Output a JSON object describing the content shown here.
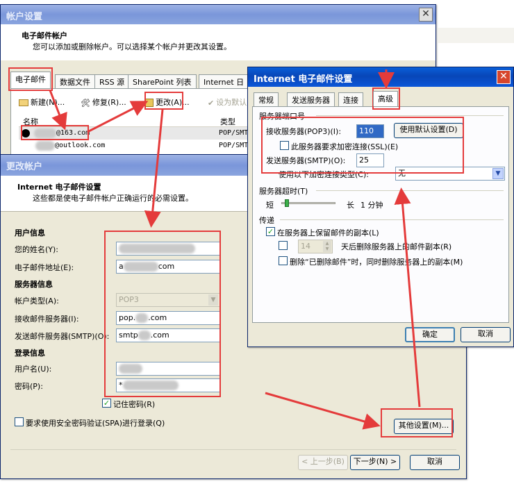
{
  "account_settings": {
    "title": "帐户设置",
    "heading": "电子邮件帐户",
    "description": "您可以添加或删除帐户。可以选择某个帐户并更改其设置。",
    "tabs": [
      "电子邮件",
      "数据文件",
      "RSS 源",
      "SharePoint 列表",
      "Internet 日"
    ],
    "toolbar": {
      "new": "新建(N)...",
      "repair": "修复(R)...",
      "change": "更改(A)...",
      "set_default": "设为默认"
    },
    "columns": {
      "name": "名称",
      "type": "类型"
    },
    "accounts": [
      {
        "name": "@163.com",
        "type": "POP/SMT"
      },
      {
        "name": "@outlook.com",
        "type": "POP/SMT"
      }
    ]
  },
  "change_account": {
    "title": "更改帐户",
    "heading": "Internet 电子邮件设置",
    "description": "这些都是使电子邮件帐户正确运行的必需设置。",
    "user_info": {
      "section": "用户信息",
      "name_label": "您的姓名(Y):",
      "email_label": "电子邮件地址(E):",
      "email_value": "com"
    },
    "server_info": {
      "section": "服务器信息",
      "account_type_label": "帐户类型(A):",
      "account_type_value": "POP3",
      "incoming_label": "接收邮件服务器(I):",
      "incoming_value": ".com",
      "outgoing_label": "发送邮件服务器(SMTP)(O):",
      "outgoing_value": ".com"
    },
    "login_info": {
      "section": "登录信息",
      "username_label": "用户名(U):",
      "password_label": "密码(P):",
      "password_value": "*"
    },
    "remember_password": "记住密码(R)",
    "spa": "要求使用安全密码验证(SPA)进行登录(Q)",
    "more_settings": "其他设置(M)...",
    "back": "< 上一步(B)",
    "next": "下一步(N) >",
    "cancel": "取消"
  },
  "internet_settings": {
    "title": "Internet 电子邮件设置",
    "tabs": [
      "常规",
      "发送服务器",
      "连接",
      "高级"
    ],
    "ports_section": "服务器端口号",
    "incoming_label": "接收服务器(POP3)(I):",
    "incoming_port": "110",
    "use_defaults": "使用默认设置(D)",
    "ssl_label": "此服务器要求加密连接(SSL)(E)",
    "outgoing_label": "发送服务器(SMTP)(O):",
    "outgoing_port": "25",
    "encryption_label": "使用以下加密连接类型(C):",
    "encryption_value": "无",
    "timeout_section": "服务器超时(T)",
    "timeout_short": "短",
    "timeout_long": "长",
    "timeout_value": "1 分钟",
    "delivery_section": "传递",
    "leave_copy": "在服务器上保留邮件的副本(L)",
    "remove_after_days": "14",
    "remove_after_label": "天后删除服务器上的邮件副本(R)",
    "remove_when_deleted": "删除“已删除邮件”时，同时删除服务器上的副本(M)",
    "ok": "确定",
    "cancel": "取消"
  },
  "colors": {
    "annotation": "#e43b3b",
    "xp_title": "#0846b8"
  }
}
